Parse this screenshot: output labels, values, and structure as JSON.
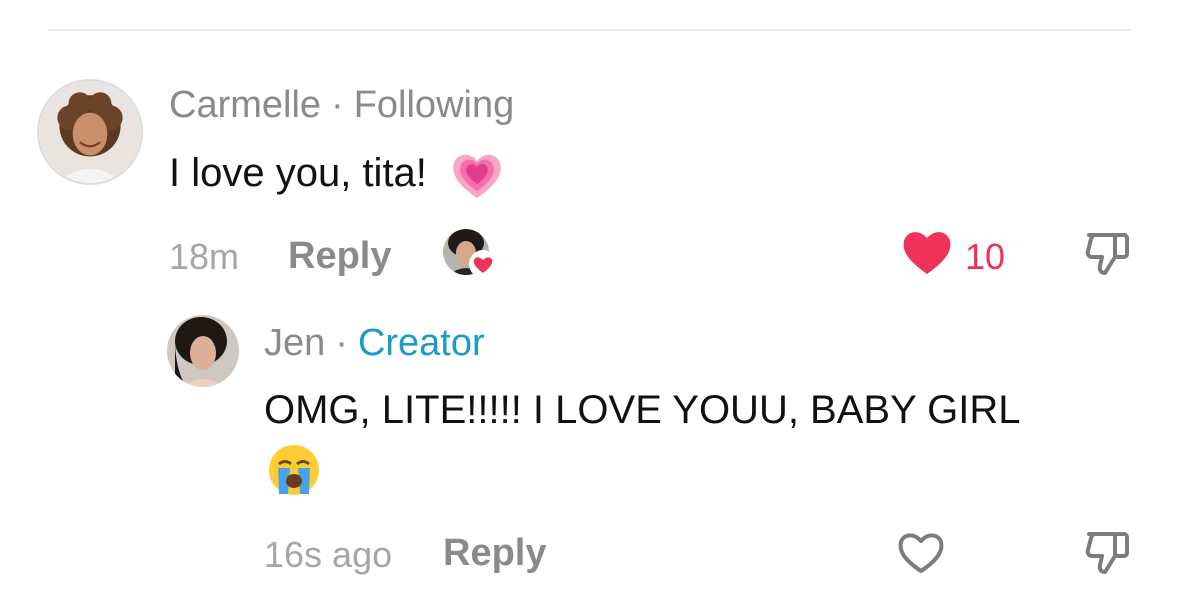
{
  "comment": {
    "author": "Carmelle",
    "separator": "·",
    "relation": "Following",
    "text": "I love you, tita!",
    "emoji": "heart-growing",
    "time": "18m",
    "reply_label": "Reply",
    "like_count": "10",
    "liked_by_creator": true,
    "liked": true
  },
  "reply": {
    "author": "Jen",
    "separator": "·",
    "badge": "Creator",
    "text": "OMG, LITE!!!!! I LOVE YOUU, BABY GIRL",
    "emoji": "loudly-crying-face",
    "time": "16s ago",
    "reply_label": "Reply",
    "liked": false
  },
  "colors": {
    "like_red": "#f0315a",
    "creator_blue": "#1a9cc4",
    "meta_gray": "#8a8a8a"
  }
}
